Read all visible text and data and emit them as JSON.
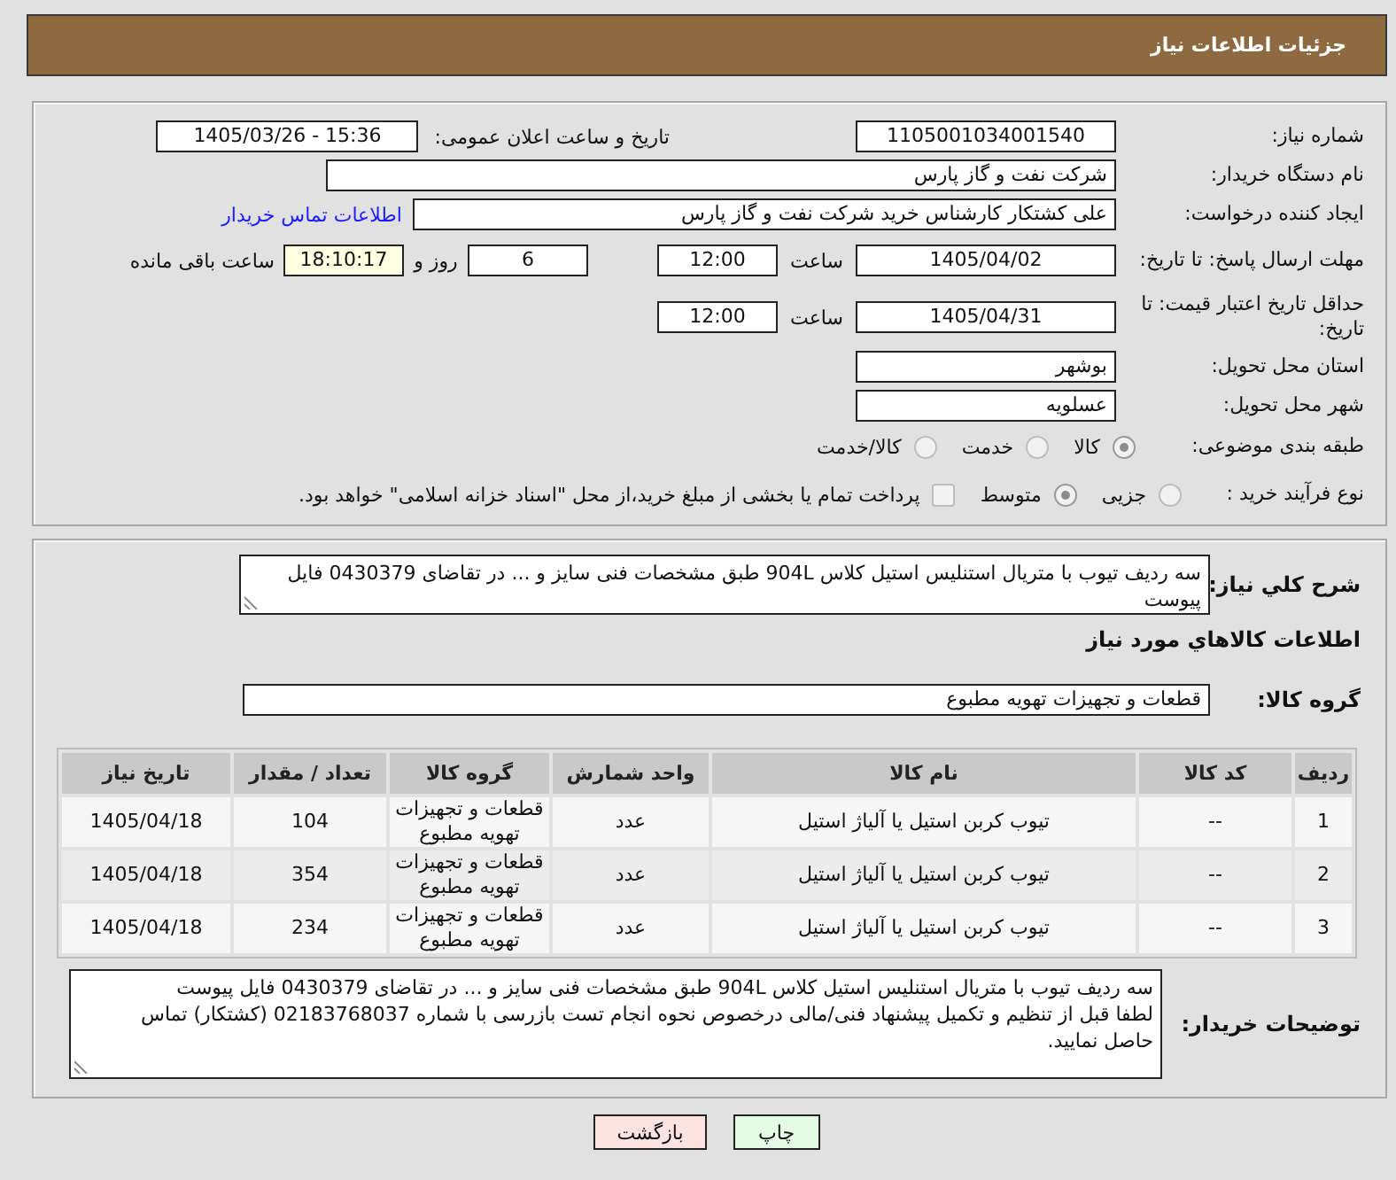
{
  "header": {
    "title": "جزئیات اطلاعات نیاز"
  },
  "details": {
    "need_number": {
      "label": "شماره نیاز:",
      "value": "1105001034001540"
    },
    "announce": {
      "label": "تاریخ و ساعت اعلان عمومی:",
      "value": "1405/03/26 - 15:36"
    },
    "buyer_org": {
      "label": "نام دستگاه خریدار:",
      "value": "شرکت نفت و گاز پارس"
    },
    "requester": {
      "label": "ایجاد کننده درخواست:",
      "value": "علی کشتکار کارشناس خرید شرکت نفت و گاز پارس",
      "link": "اطلاعات تماس خریدار"
    },
    "response_deadline": {
      "label": "مهلت ارسال پاسخ: تا تاریخ:",
      "date": "1405/04/02",
      "time_label": "ساعت",
      "time": "12:00",
      "days": "6",
      "days_label": "روز و",
      "remaining": "18:10:17",
      "remaining_label": "ساعت باقی مانده"
    },
    "price_validity": {
      "label": "حداقل تاریخ اعتبار قیمت: تا تاریخ:",
      "date": "1405/04/31",
      "time_label": "ساعت",
      "time": "12:00"
    },
    "province": {
      "label": "استان محل تحویل:",
      "value": "بوشهر"
    },
    "city": {
      "label": "شهر محل تحویل:",
      "value": "عسلویه"
    },
    "classification": {
      "label": "طبقه بندی موضوعی:",
      "options": [
        {
          "label": "کالا",
          "selected": true
        },
        {
          "label": "خدمت",
          "selected": false
        },
        {
          "label": "کالا/خدمت",
          "selected": false
        }
      ]
    },
    "process": {
      "label": "نوع فرآیند خرید :",
      "options": [
        {
          "label": "جزیی",
          "selected": false
        },
        {
          "label": "متوسط",
          "selected": true
        }
      ],
      "treasury": {
        "label": "پرداخت تمام یا بخشی از مبلغ خرید،از محل \"اسناد خزانه اسلامی\" خواهد بود.",
        "checked": false
      }
    }
  },
  "summary": {
    "label": "شرح كلي نياز:",
    "value": "سه ردیف تیوب با متریال استنلیس استیل کلاس 904L طبق مشخصات فنی سایز و ... در تقاضای 0430379 فایل پیوست"
  },
  "goods": {
    "title": "اطلاعات كالاهاي مورد نياز",
    "group_label": "گروه کالا:",
    "group_value": "قطعات و تجهیزات تهویه مطبوع",
    "table": {
      "columns": [
        "ردیف",
        "کد کالا",
        "نام کالا",
        "واحد شمارش",
        "گروه کالا",
        "تعداد / مقدار",
        "تاریخ نیاز"
      ],
      "rows": [
        [
          "1",
          "--",
          "تیوب کربن استیل یا آلیاژ استیل",
          "عدد",
          "قطعات و تجهیزات تهویه مطبوع",
          "104",
          "1405/04/18"
        ],
        [
          "2",
          "--",
          "تیوب کربن استیل یا آلیاژ استیل",
          "عدد",
          "قطعات و تجهیزات تهویه مطبوع",
          "354",
          "1405/04/18"
        ],
        [
          "3",
          "--",
          "تیوب کربن استیل یا آلیاژ استیل",
          "عدد",
          "قطعات و تجهیزات تهویه مطبوع",
          "234",
          "1405/04/18"
        ]
      ]
    }
  },
  "buyer_notes": {
    "label": "توضیحات خریدار:",
    "value": "سه ردیف تیوب با متریال استنلیس استیل کلاس 904L طبق مشخصات فنی سایز و ... در تقاضای 0430379 فایل پیوست\nلطفا قبل از تنظیم و تکمیل پیشنهاد فنی/مالی درخصوص نحوه انجام تست بازرسی با شماره 02183768037 (کشتکار) تماس حاصل نمایید."
  },
  "buttons": [
    {
      "label": "چاپ",
      "kind": "print"
    },
    {
      "label": "بازگشت",
      "kind": "back"
    }
  ]
}
